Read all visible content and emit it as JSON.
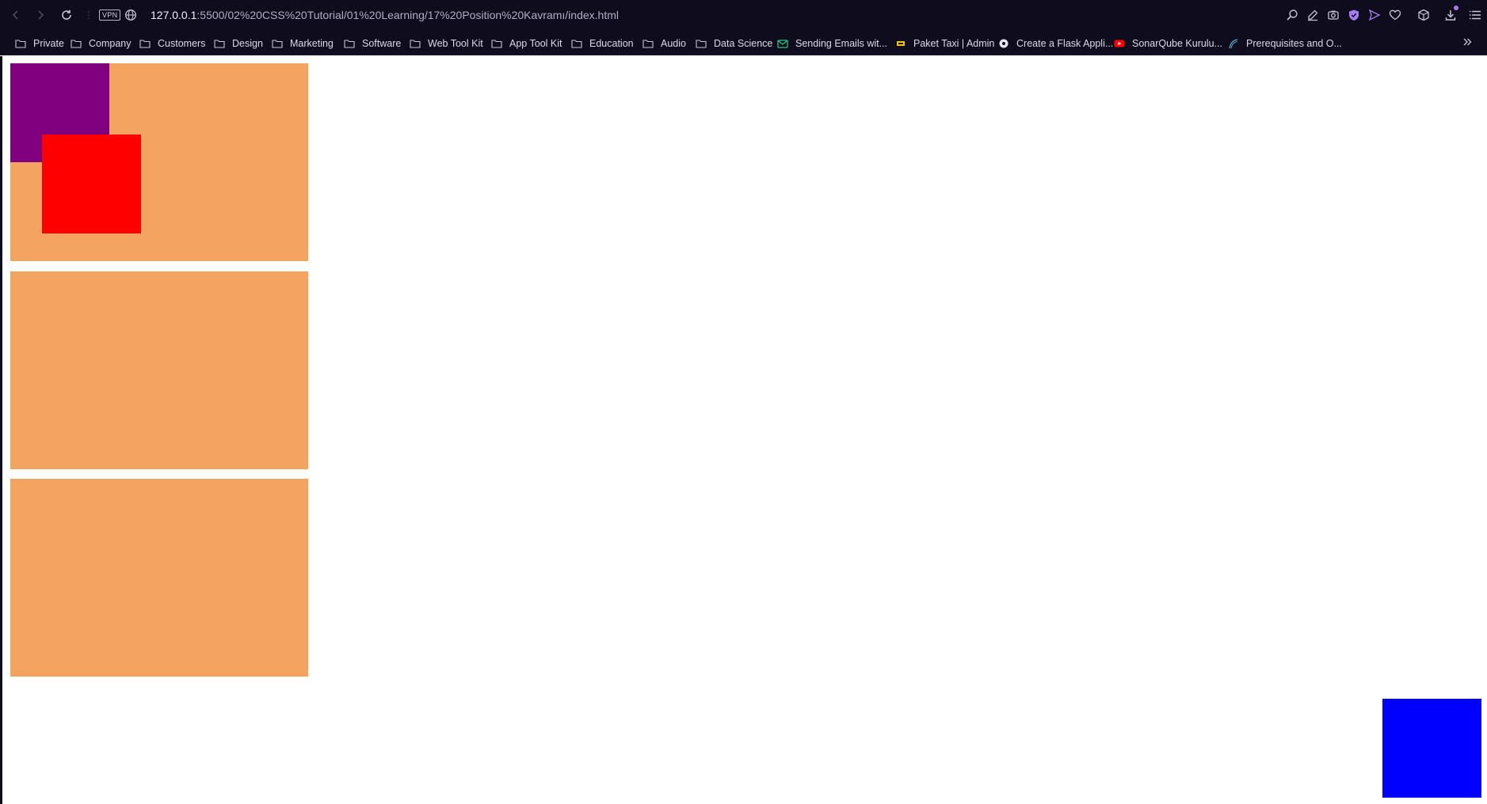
{
  "toolbar": {
    "back_icon": "back-arrow-icon",
    "forward_icon": "forward-arrow-icon",
    "reload_icon": "reload-icon",
    "vpn_label": "VPN",
    "url_host": "127.0.0.1",
    "url_path": ":5500/02%20CSS%20Tutorial/01%20Learning/17%20Position%20Kavramı/index.html",
    "right_icons": [
      "zoom-icon",
      "edit-icon",
      "camera-icon",
      "shield-icon",
      "send-icon",
      "heart-icon",
      "box-icon",
      "download-icon",
      "menu-icon"
    ]
  },
  "bookmarks": {
    "items": [
      {
        "label": "Private",
        "icon": "folder-icon"
      },
      {
        "label": "Company",
        "icon": "folder-icon"
      },
      {
        "label": "Customers",
        "icon": "folder-icon"
      },
      {
        "label": "Design",
        "icon": "folder-icon"
      },
      {
        "label": "Marketing",
        "icon": "folder-icon"
      },
      {
        "label": "Software",
        "icon": "folder-icon"
      },
      {
        "label": "Web Tool Kit",
        "icon": "folder-icon"
      },
      {
        "label": "App Tool Kit",
        "icon": "folder-icon"
      },
      {
        "label": "Education",
        "icon": "folder-icon"
      },
      {
        "label": "Audio",
        "icon": "folder-icon"
      },
      {
        "label": "Data Science",
        "icon": "folder-icon"
      },
      {
        "label": "Sending Emails wit...",
        "icon": "mail-icon"
      },
      {
        "label": "Paket Taxi | Admin",
        "icon": "taxi-icon"
      },
      {
        "label": "Create a Flask Appli...",
        "icon": "flask-icon"
      },
      {
        "label": "SonarQube Kurulu...",
        "icon": "youtube-icon"
      },
      {
        "label": "Prerequisites and O...",
        "icon": "wave-icon"
      }
    ],
    "more_icon": "chevron-double-right-icon"
  },
  "page": {
    "colors": {
      "box": "#f4a460",
      "purple": "#800080",
      "red": "#ff0000",
      "blue": "#0000ff"
    }
  }
}
